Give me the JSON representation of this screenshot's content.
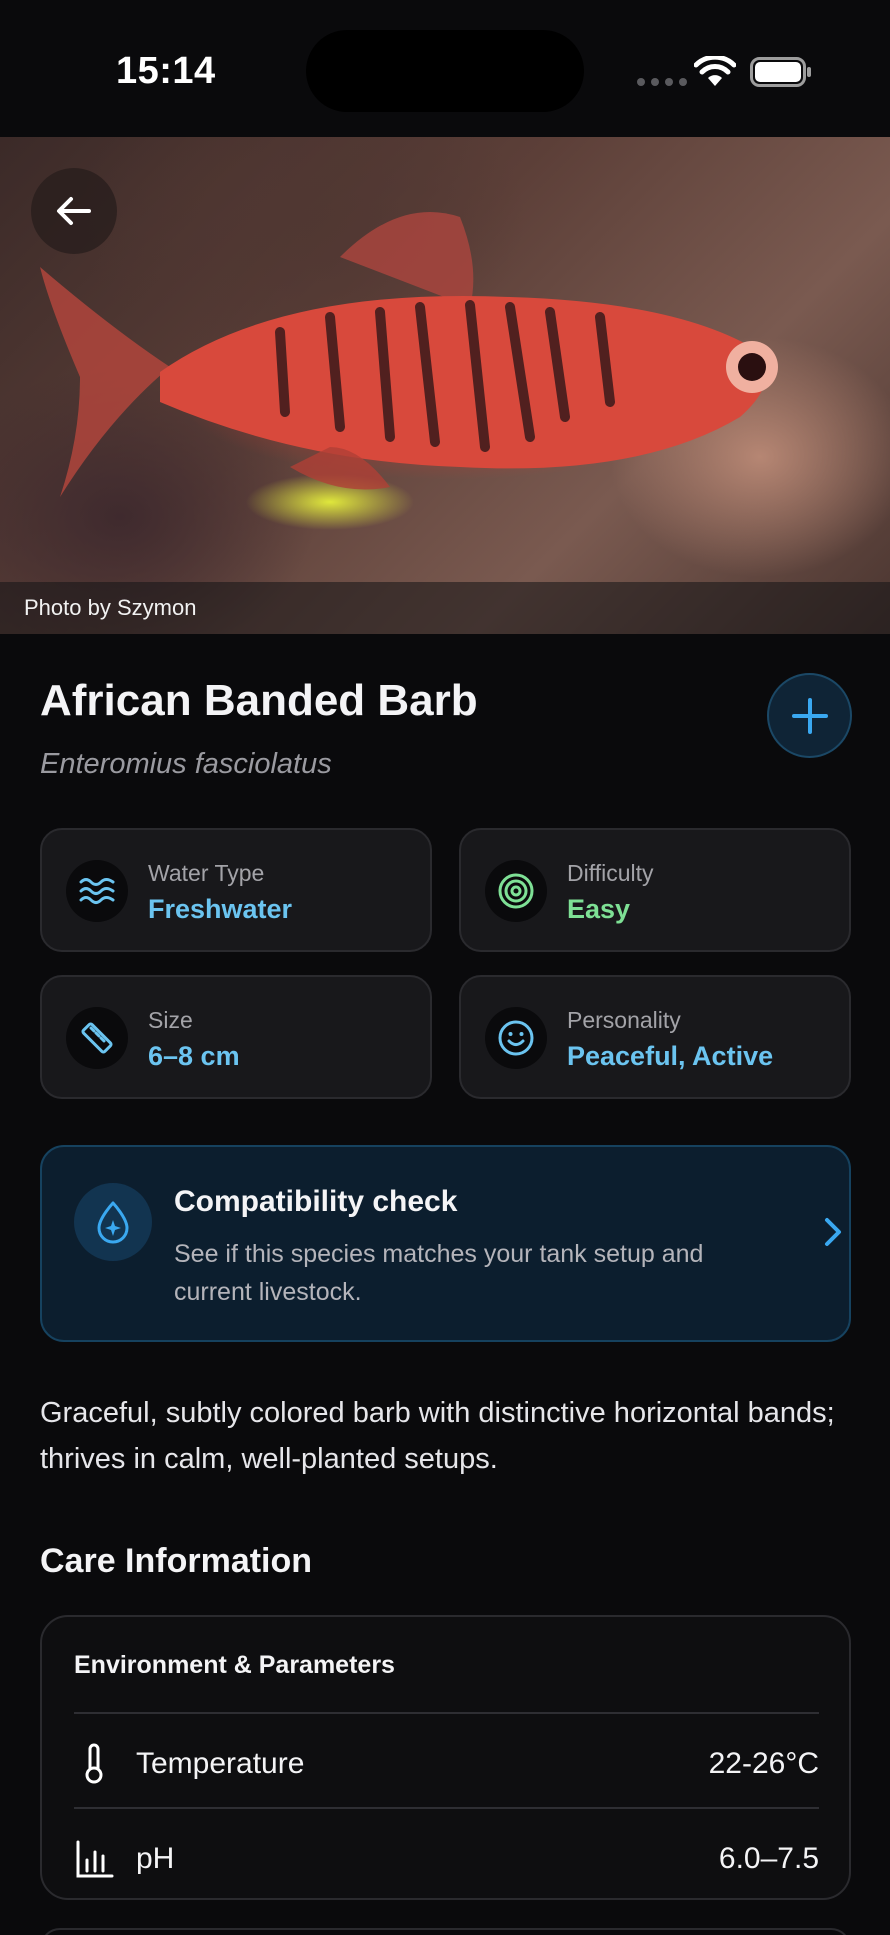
{
  "status_bar": {
    "time": "15:14"
  },
  "hero": {
    "caption": "Photo by Szymon"
  },
  "species": {
    "common_name": "African Banded Barb",
    "scientific_name": "Enteromius fasciolatus"
  },
  "icons": {
    "back": "arrow-left-icon",
    "add": "plus-icon",
    "water_type": "waves-icon",
    "difficulty": "target-icon",
    "size": "ruler-icon",
    "personality": "smiley-icon",
    "compatibility": "water-drop-sparkle-icon",
    "temperature": "thermometer-icon",
    "ph": "bar-chart-icon"
  },
  "info_cards": [
    {
      "label": "Water Type",
      "value": "Freshwater"
    },
    {
      "label": "Difficulty",
      "value": "Easy"
    },
    {
      "label": "Size",
      "value": "6–8 cm"
    },
    {
      "label": "Personality",
      "value": "Peaceful, Active"
    }
  ],
  "compatibility": {
    "title": "Compatibility check",
    "description": "See if this species matches your tank setup and current livestock."
  },
  "description": "Graceful, subtly colored barb with distinctive horizontal bands; thrives in calm, well-planted setups.",
  "care": {
    "section_title": "Care Information",
    "environment": {
      "title": "Environment & Parameters",
      "rows": [
        {
          "name": "Temperature",
          "value": "22-26°C"
        },
        {
          "name": "pH",
          "value": "6.0–7.5"
        }
      ]
    }
  },
  "colors": {
    "background": "#0a0a0c",
    "accent_blue": "#6bc4f0",
    "accent_green": "#7ee095",
    "card": "#18181b"
  }
}
